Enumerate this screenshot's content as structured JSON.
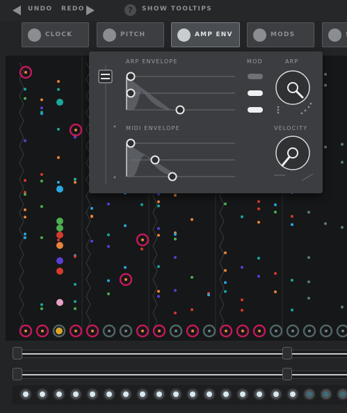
{
  "toolbar": {
    "undo_label": "UNDO",
    "redo_label": "REDO",
    "tooltips_label": "SHOW TOOLTIPS",
    "help_glyph": "?"
  },
  "tabs": [
    {
      "label": "CLOCK",
      "icon": "clock-icon",
      "active": false
    },
    {
      "label": "PITCH",
      "icon": "note-icon",
      "active": false
    },
    {
      "label": "AMP ENV",
      "icon": "speaker-icon",
      "active": true
    },
    {
      "label": "MODS",
      "icon": "mods-icon",
      "active": false
    },
    {
      "label": "S",
      "icon": "wave-icon",
      "active": false
    }
  ],
  "popup": {
    "arp_envelope_label": "ARP ENVELOPE",
    "midi_envelope_label": "MIDI ENVELOPE",
    "mod_label": "MOD",
    "arp_label": "ARP",
    "velocity_label": "VELOCITY",
    "arp_envelope_values": [
      0.0,
      0.0,
      0.52
    ],
    "midi_envelope_values": [
      0.0,
      0.27,
      0.44
    ],
    "mod_toggles": [
      false,
      true,
      true
    ],
    "arp_knob_value": 0.6,
    "velocity_knob_value": 0.38
  },
  "colors": {
    "accent_pink": "#c2185b",
    "dot_blue": "#2aa8e0",
    "dot_green": "#4caf50",
    "dot_orange": "#e8833a",
    "dot_teal": "#1aa79c",
    "dot_yellow": "#d8a528",
    "dot_red": "#d43b2f",
    "dot_violet": "#5a3fd6",
    "dot_pink": "#e8a2c8"
  }
}
